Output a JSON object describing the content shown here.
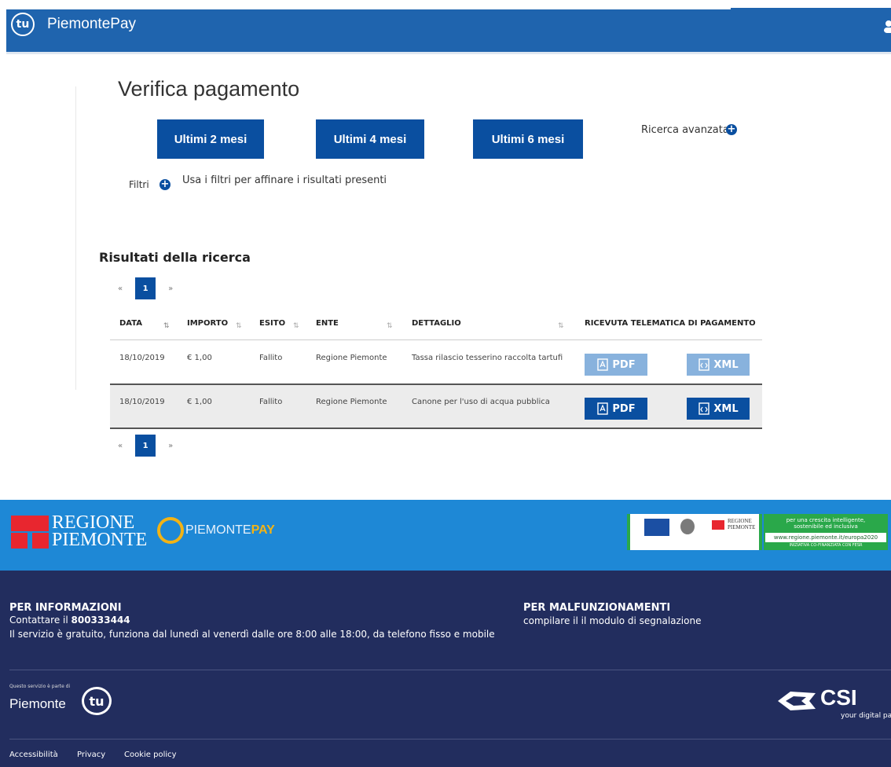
{
  "header": {
    "logo_text": "tu",
    "brand": "PiemontePay"
  },
  "page": {
    "title": "Verifica pagamento",
    "period_buttons": [
      "Ultimi 2 mesi",
      "Ultimi 4 mesi",
      "Ultimi 6 mesi"
    ],
    "advanced_search": "Ricerca avanzata",
    "filters_label": "Filtri",
    "filters_desc": "Usa i filtri per affinare i risultati presenti",
    "results_title": "Risultati della ricerca"
  },
  "pager": {
    "prev": "«",
    "current": "1",
    "next": "»"
  },
  "table": {
    "headers": [
      "DATA",
      "IMPORTO",
      "ESITO",
      "ENTE",
      "DETTAGLIO",
      "RICEVUTA TELEMATICA DI PAGAMENTO"
    ],
    "rows": [
      {
        "date": "18/10/2019",
        "amount": "€ 1,00",
        "outcome": "Fallito",
        "ente": "Regione Piemonte",
        "detail": "Tassa rilascio tesserino raccolta tartufi",
        "pdf": "PDF",
        "xml": "XML",
        "enabled": false
      },
      {
        "date": "18/10/2019",
        "amount": "€ 1,00",
        "outcome": "Fallito",
        "ente": "Regione Piemonte",
        "detail": "Canone per l'uso di acqua pubblica",
        "pdf": "PDF",
        "xml": "XML",
        "enabled": true
      }
    ]
  },
  "footer": {
    "regione_line1": "REGIONE",
    "regione_line2": "PIEMONTE",
    "pp_part1": "PIEMONTE",
    "pp_part2": "PAY",
    "eu_regione_line1": "REGIONE",
    "eu_regione_line2": "PIEMONTE",
    "eu_line1": "per una crescita intelligente,",
    "eu_line2": "sostenibile ed inclusiva",
    "eu_url": "www.regione.piemonte.it/europa2020",
    "eu_bottom": "INIZIATIVA CO-FINANZIATA CON FESR",
    "info_title": "PER INFORMAZIONI",
    "info_contact_prefix": "Contattare il ",
    "info_number": "800333444",
    "info_text": "Il servizio è gratuito, funziona dal lunedì al venerdì dalle ore 8:00 alle 18:00, da telefono fisso e mobile",
    "malf_title": "PER MALFUNZIONAMENTI",
    "malf_text": "compilare il il modulo di segnalazione",
    "piemonte_small": "Questo servizio è parte di",
    "piemonte_word": "Piemonte",
    "tu_text": "tu",
    "csi_text": "CSI",
    "csi_tagline": "your digital partner",
    "links": [
      "Accessibilità",
      "Privacy",
      "Cookie policy"
    ]
  },
  "colors": {
    "primary": "#0a4fa0",
    "header": "#1f64ae",
    "footer_top": "#1e88d6",
    "footer_dark": "#222d5e",
    "disabled": "#88b2dd"
  }
}
